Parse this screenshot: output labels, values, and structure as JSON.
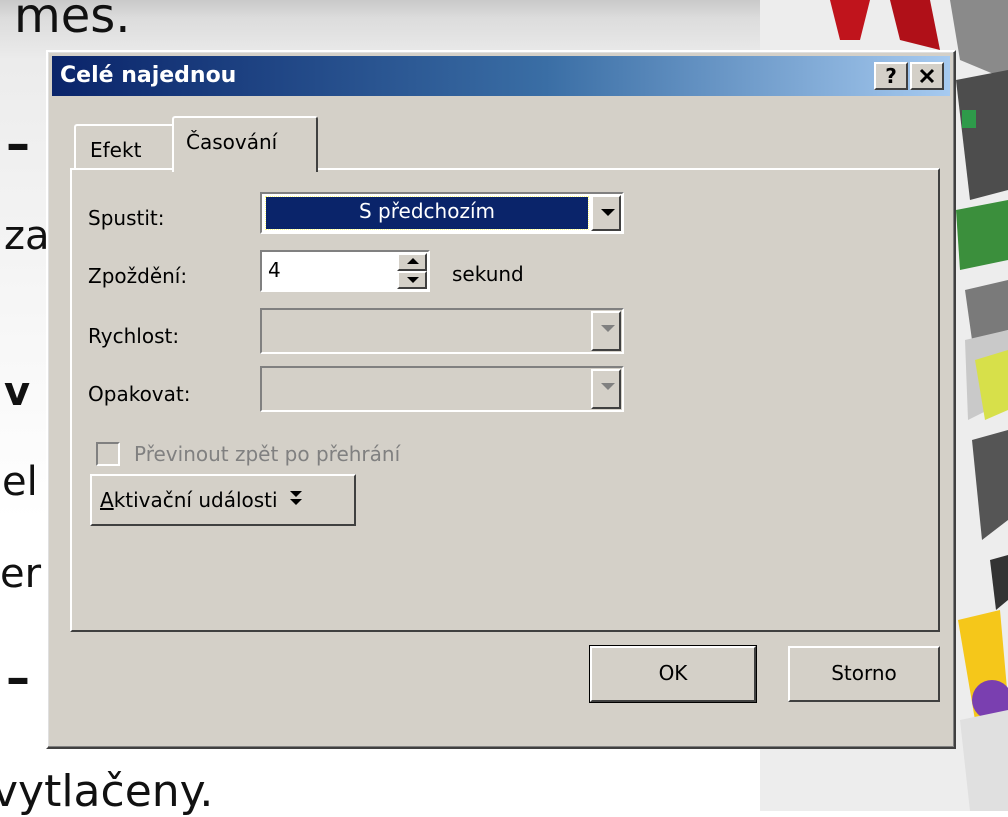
{
  "background_slide": {
    "text_top": "mes.",
    "text_dash1": "–",
    "text_za": "za",
    "text_v": "v",
    "text_el": "el",
    "text_er": "er",
    "text_dash2": "–",
    "text_bottom": "vytlačeny."
  },
  "dialog": {
    "title": "Celé najednou",
    "help_label": "?",
    "close_label": "✕",
    "tabs": [
      {
        "label": "Efekt",
        "active": false
      },
      {
        "label": "Časování",
        "active": true
      }
    ],
    "spustit": {
      "label": "Spustit:",
      "value": "S předchozím"
    },
    "zpozdeni": {
      "label": "Zpoždění:",
      "value": "4",
      "unit": "sekund"
    },
    "rychlost": {
      "label": "Rychlost:",
      "value": ""
    },
    "opakovat": {
      "label": "Opakovat:",
      "value": ""
    },
    "rewind_checkbox": {
      "label": "Převinout zpět po přehrání",
      "checked": false
    },
    "triggers_button": {
      "accel": "A",
      "label_rest": "ktivační události"
    },
    "ok_label": "OK",
    "cancel_label": "Storno"
  },
  "colors": {
    "title_start": "#0a246a",
    "title_end": "#a6caf0",
    "dialog_face": "#d4d0c8",
    "selection": "#0a246a"
  }
}
